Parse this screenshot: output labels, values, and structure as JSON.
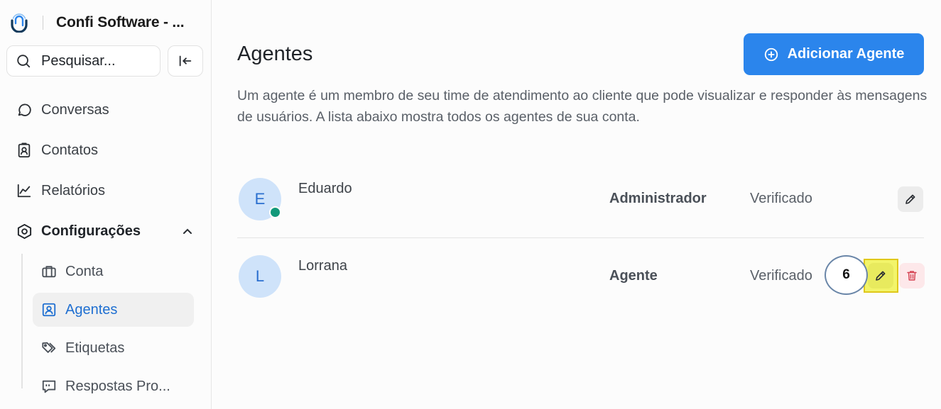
{
  "sidebar": {
    "brand_name": "Confi Software - ...",
    "search_placeholder": "Pesquisar...",
    "nav": [
      {
        "label": "Conversas",
        "icon": "chat-bubble-icon"
      },
      {
        "label": "Contatos",
        "icon": "contact-card-icon"
      },
      {
        "label": "Relatórios",
        "icon": "line-chart-icon"
      },
      {
        "label": "Configurações",
        "icon": "settings-hexagon-icon"
      }
    ],
    "settings_items": [
      {
        "label": "Conta",
        "icon": "briefcase-icon"
      },
      {
        "label": "Agentes",
        "icon": "agent-icon",
        "active": true
      },
      {
        "label": "Etiquetas",
        "icon": "tags-icon"
      },
      {
        "label": "Respostas Pro...",
        "icon": "canned-response-icon"
      }
    ]
  },
  "main": {
    "title": "Agentes",
    "add_button_label": "Adicionar Agente",
    "description": "Um agente é um membro de seu time de atendimento ao cliente que pode visualizar e responder às mensagens de usuários. A lista abaixo mostra todos os agentes de sua conta.",
    "agents": [
      {
        "initial": "E",
        "name": "Eduardo",
        "role": "Administrador",
        "status": "Verificado",
        "online": true
      },
      {
        "initial": "L",
        "name": "Lorrana",
        "role": "Agente",
        "status": "Verificado",
        "online": false
      }
    ]
  },
  "annotation": {
    "marker_label": "6",
    "highlight_color": "#f2f46a"
  },
  "colors": {
    "accent": "#2b85ec",
    "online": "#12997a",
    "active_text": "#1f6fd1"
  }
}
